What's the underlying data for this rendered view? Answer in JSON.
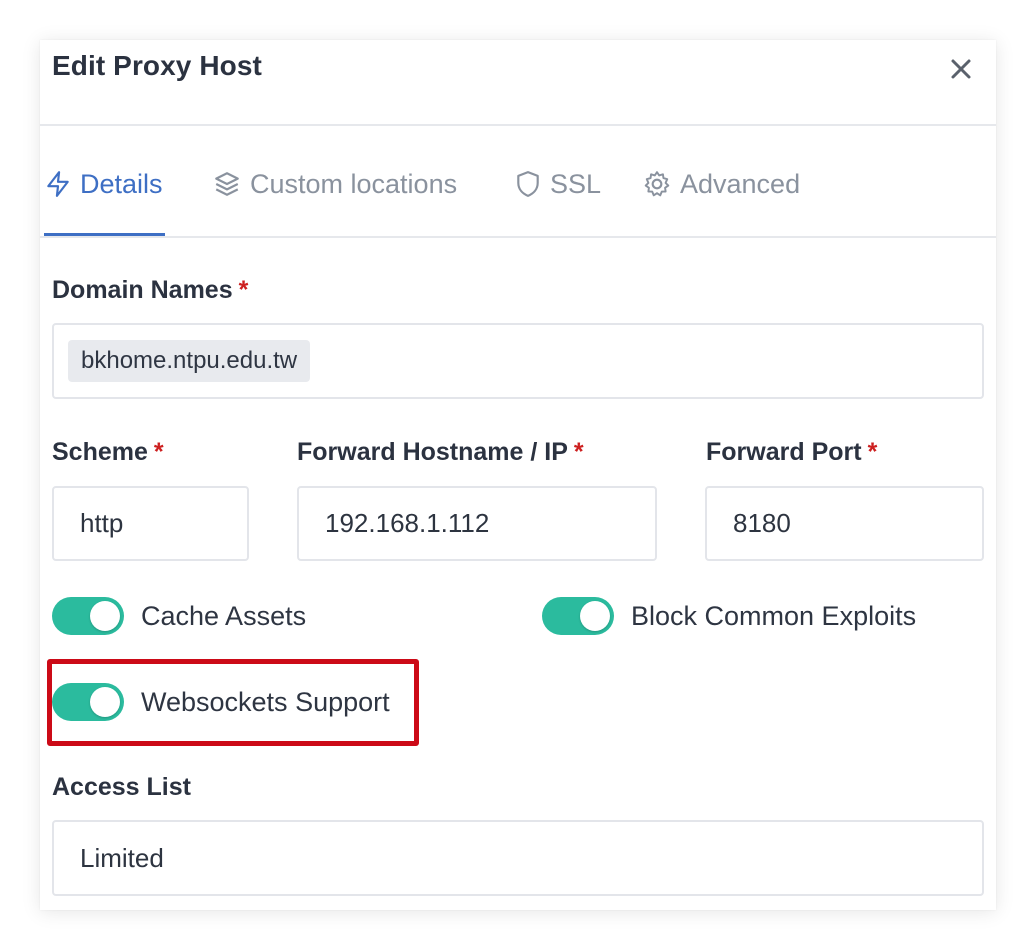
{
  "modal": {
    "title": "Edit Proxy Host",
    "close_icon": "close-icon"
  },
  "tabs": [
    {
      "label": "Details",
      "icon": "lightning-icon",
      "active": true
    },
    {
      "label": "Custom locations",
      "icon": "layers-icon",
      "active": false
    },
    {
      "label": "SSL",
      "icon": "shield-icon",
      "active": false
    },
    {
      "label": "Advanced",
      "icon": "gear-icon",
      "active": false
    }
  ],
  "form": {
    "domain_names": {
      "label": "Domain Names",
      "required_mark": "*",
      "chips": [
        "bkhome.ntpu.edu.tw"
      ]
    },
    "scheme": {
      "label": "Scheme",
      "required_mark": "*",
      "value": "http"
    },
    "forward_host": {
      "label": "Forward Hostname / IP",
      "required_mark": "*",
      "value": "192.168.1.112"
    },
    "forward_port": {
      "label": "Forward Port",
      "required_mark": "*",
      "value": "8180"
    },
    "toggles": {
      "cache_assets": {
        "label": "Cache Assets",
        "on": true
      },
      "block_exploits": {
        "label": "Block Common Exploits",
        "on": true
      },
      "websockets": {
        "label": "Websockets Support",
        "on": true
      }
    },
    "access_list": {
      "label": "Access List",
      "value": "Limited"
    }
  },
  "colors": {
    "accent": "#3e6fc4",
    "toggle_on": "#2bbb9e",
    "required": "#cd2020",
    "highlight": "#cc0a17"
  }
}
